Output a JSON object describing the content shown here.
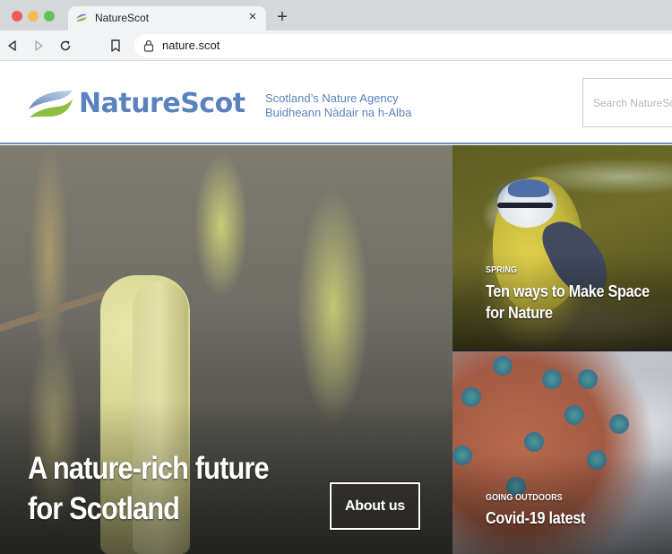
{
  "browser": {
    "tab": {
      "title": "NatureScot",
      "favicon": "naturescot-leaf-icon",
      "close_icon": "close-icon"
    },
    "new_tab_icon": "plus-icon",
    "nav": {
      "back_icon": "back-arrow-icon",
      "forward_icon": "forward-arrow-icon",
      "reload_icon": "reload-icon",
      "bookmark_icon": "bookmark-icon"
    },
    "address_bar": {
      "lock_icon": "lock-icon",
      "url": "nature.scot"
    }
  },
  "site": {
    "logo": {
      "wordmark": "NatureScot",
      "tagline_en": "Scotland’s Nature Agency",
      "tagline_gd": "Buidheann Nàdair na h-Alba"
    },
    "search": {
      "placeholder": "Search NatureScot",
      "value": ""
    },
    "colors": {
      "brand_blue": "#5b82bf",
      "brand_green": "#8cbf3f",
      "divider_blue": "#6b8fc2"
    },
    "hero": {
      "title_line1": "A nature-rich future",
      "title_line2": "for Scotland",
      "button_label": "About us",
      "image": "hazel-catkins-photo"
    },
    "cards": [
      {
        "kicker": "SPRING",
        "title_line1": "Ten ways to Make Space",
        "title_line2": "for Nature",
        "image": "blue-tit-photo"
      },
      {
        "kicker": "GOING OUTDOORS",
        "title_line1": "Covid-19 latest",
        "image": "coronavirus-photo"
      }
    ]
  }
}
